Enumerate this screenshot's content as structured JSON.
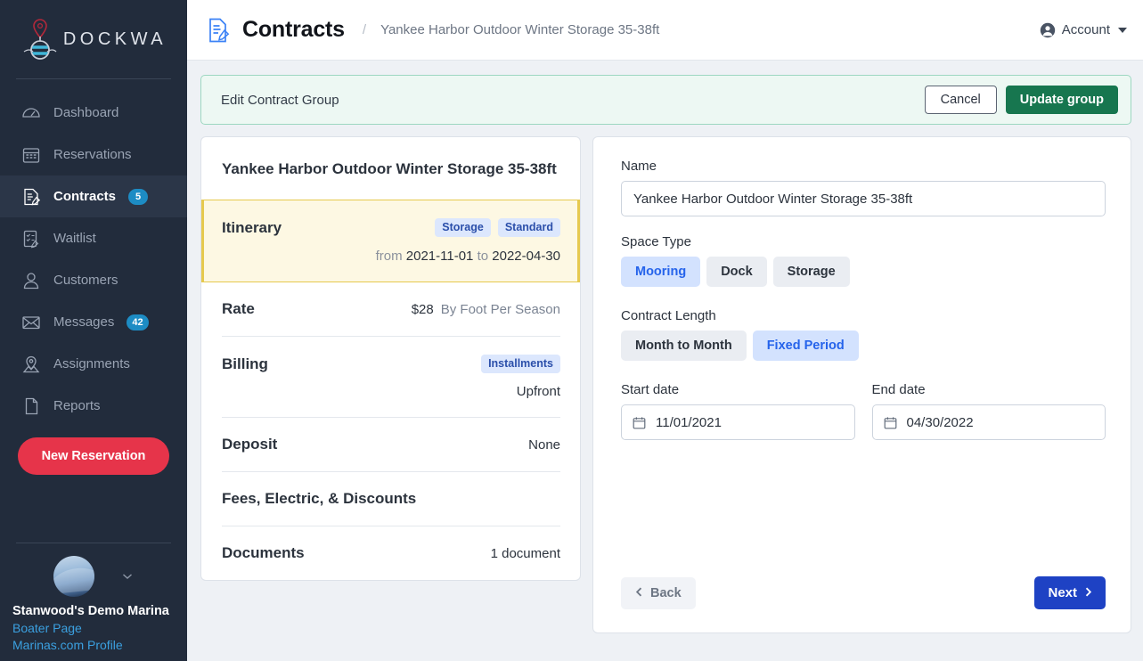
{
  "brand": {
    "name": "DOCKWA",
    "logo_icon": "buoy-pin-logo"
  },
  "sidebar": {
    "items": [
      {
        "label": "Dashboard",
        "icon": "gauge-icon",
        "badge": ""
      },
      {
        "label": "Reservations",
        "icon": "calendar-icon",
        "badge": ""
      },
      {
        "label": "Contracts",
        "icon": "contract-icon",
        "badge": "5"
      },
      {
        "label": "Waitlist",
        "icon": "checklist-icon",
        "badge": ""
      },
      {
        "label": "Customers",
        "icon": "person-icon",
        "badge": ""
      },
      {
        "label": "Messages",
        "icon": "envelope-icon",
        "badge": "42"
      },
      {
        "label": "Assignments",
        "icon": "map-pin-icon",
        "badge": ""
      },
      {
        "label": "Reports",
        "icon": "page-icon",
        "badge": ""
      }
    ],
    "new_reservation_label": "New Reservation",
    "account": {
      "marina_name": "Stanwood's Demo Marina",
      "links": [
        "Boater Page",
        "Marinas.com Profile"
      ],
      "chevron_icon": "chevron-down-icon"
    }
  },
  "header": {
    "icon": "contract-icon",
    "title": "Contracts",
    "separator": "/",
    "breadcrumb": "Yankee Harbor Outdoor Winter Storage 35-38ft",
    "account_label": "Account",
    "account_icon": "person-circle-icon"
  },
  "editbar": {
    "title": "Edit Contract Group",
    "cancel_label": "Cancel",
    "update_label": "Update group",
    "accent_color": "#17764f"
  },
  "summary": {
    "heading": "Yankee Harbor Outdoor Winter Storage 35-38ft",
    "itinerary": {
      "label": "Itinerary",
      "tags": [
        "Storage",
        "Standard"
      ],
      "from_word": "from",
      "start": "2021-11-01",
      "to_word": "to",
      "end": "2022-04-30"
    },
    "rows": [
      {
        "label": "Rate",
        "value": "$28",
        "value_muted": "By Foot Per Season",
        "tag": "",
        "sub": ""
      },
      {
        "label": "Billing",
        "value": "",
        "value_muted": "",
        "tag": "Installments",
        "sub": "Upfront"
      },
      {
        "label": "Deposit",
        "value": "None",
        "value_muted": "",
        "tag": "",
        "sub": ""
      },
      {
        "label": "Fees, Electric, & Discounts",
        "value": "",
        "value_muted": "",
        "tag": "",
        "sub": ""
      },
      {
        "label": "Documents",
        "value": "1 document",
        "value_muted": "",
        "tag": "",
        "sub": ""
      }
    ]
  },
  "form": {
    "name_label": "Name",
    "name_value": "Yankee Harbor Outdoor Winter Storage 35-38ft",
    "name_placeholder": "Name",
    "space_type_label": "Space Type",
    "space_types": [
      "Mooring",
      "Dock",
      "Storage"
    ],
    "space_type_selected": "Mooring",
    "contract_length_label": "Contract Length",
    "contract_lengths": [
      "Month to Month",
      "Fixed Period"
    ],
    "contract_length_selected": "Fixed Period",
    "start_date_label": "Start date",
    "start_date_value": "11/01/2021",
    "end_date_label": "End date",
    "end_date_value": "04/30/2022",
    "calendar_icon": "calendar-icon",
    "back_label": "Back",
    "next_label": "Next",
    "next_color": "#1e42c4"
  }
}
